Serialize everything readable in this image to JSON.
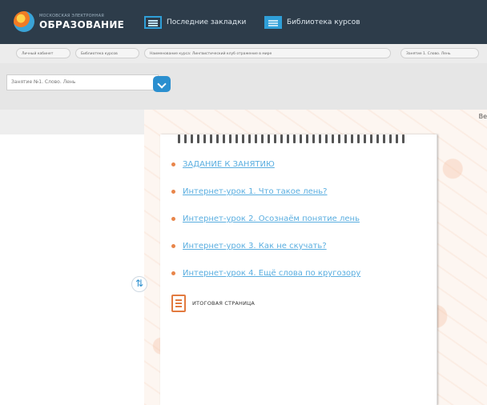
{
  "brand": {
    "small_text": "МОСКОВСКАЯ ЭЛЕКТРОННАЯ",
    "big_text": "ОБРАЗОВАНИЕ"
  },
  "nav": {
    "recent": "Последние закладки",
    "library": "Библиотека курсов"
  },
  "breadcrumbs": [
    "Личный кабинет",
    "Библиотека курсов",
    "Наименование курса: Лингвистический клуб отражение в мире",
    "Занятие 1. Слово. Лень"
  ],
  "lesson_select": {
    "value": "Занятие №1. Слово. Лень"
  },
  "header_cut_text": "Ве",
  "tasks": [
    "ЗАДАНИЕ К ЗАНЯТИЮ",
    "Интернет-урок 1. Что такое лень?",
    "Интернет-урок 2. Осознаём понятие лень",
    "Интернет-урок 3. Как не скучать?",
    "Интернет-урок 4. Ещё слова по кругозору"
  ],
  "final_page": {
    "label": "ИТОГОВАЯ СТРАНИЦА"
  },
  "colors": {
    "header": "#2d3c4a",
    "accent": "#2f9fd8",
    "link": "#5aaee0",
    "bullet": "#e8854a"
  }
}
